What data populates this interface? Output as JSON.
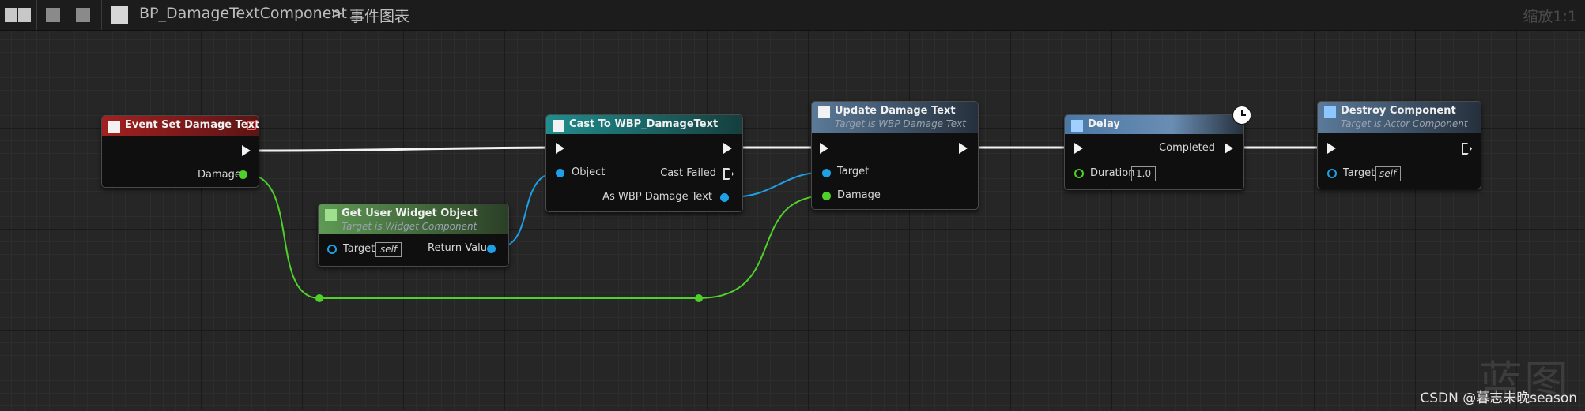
{
  "toolbar": {
    "blueprint_name": "BP_DamageTextComponent",
    "breadcrumb_separator": ">",
    "graph_name": "事件图表",
    "zoom": "缩放1:1"
  },
  "colors": {
    "exec": "#f2f2f2",
    "object": "#1ea0e6",
    "float": "#4fd12a",
    "event_header": "#8a1c1c",
    "pure_header": "#3e6b35",
    "cast_header": "#1c6a6c",
    "function_header": "#3b5a7a",
    "latent_header": "#355e85"
  },
  "nodes": {
    "event_set_damage_text": {
      "title": "Event Set Damage Text",
      "pin_damage": "Damage"
    },
    "get_user_widget_object": {
      "title": "Get User Widget Object",
      "subtitle": "Target is Widget Component",
      "pin_target": "Target",
      "target_default": "self",
      "pin_return": "Return Value"
    },
    "cast_to_wbp_damagetext": {
      "title": "Cast To WBP_DamageText",
      "pin_object": "Object",
      "pin_cast_failed": "Cast Failed",
      "pin_as": "As WBP Damage Text"
    },
    "update_damage_text": {
      "title": "Update Damage Text",
      "subtitle": "Target is WBP Damage Text",
      "pin_target": "Target",
      "pin_damage": "Damage"
    },
    "delay": {
      "title": "Delay",
      "pin_completed": "Completed",
      "pin_duration": "Duration",
      "duration_value": "1.0"
    },
    "destroy_component": {
      "title": "Destroy Component",
      "subtitle": "Target is Actor Component",
      "pin_target": "Target",
      "target_default": "self"
    }
  },
  "watermark": {
    "logo": "蓝图",
    "text": "CSDN @暮志未晚season"
  }
}
